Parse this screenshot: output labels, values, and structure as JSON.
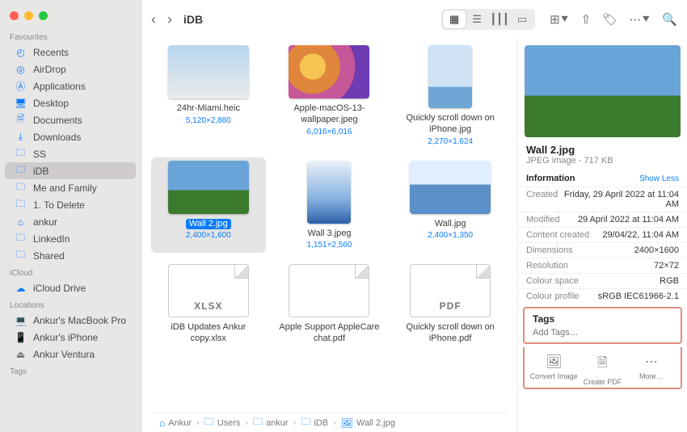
{
  "window": {
    "title": "iDB"
  },
  "sidebar": {
    "groups": [
      {
        "heading": "Favourites",
        "items": [
          {
            "label": "Recents",
            "icon": "clock"
          },
          {
            "label": "AirDrop",
            "icon": "airdrop"
          },
          {
            "label": "Applications",
            "icon": "apps"
          },
          {
            "label": "Desktop",
            "icon": "desktop"
          },
          {
            "label": "Documents",
            "icon": "doc"
          },
          {
            "label": "Downloads",
            "icon": "download"
          },
          {
            "label": "SS",
            "icon": "folder"
          },
          {
            "label": "iDB",
            "icon": "folder",
            "selected": true
          },
          {
            "label": "Me and Family",
            "icon": "folder"
          },
          {
            "label": "1. To Delete",
            "icon": "folder"
          },
          {
            "label": "ankur",
            "icon": "home"
          },
          {
            "label": "LinkedIn",
            "icon": "folder"
          },
          {
            "label": "Shared",
            "icon": "folder"
          }
        ]
      },
      {
        "heading": "iCloud",
        "items": [
          {
            "label": "iCloud Drive",
            "icon": "icloud"
          }
        ]
      },
      {
        "heading": "Locations",
        "items": [
          {
            "label": "Ankur's MacBook Pro",
            "icon": "laptop"
          },
          {
            "label": "Ankur's iPhone",
            "icon": "phone"
          },
          {
            "label": "Ankur Ventura",
            "icon": "disk"
          }
        ]
      },
      {
        "heading": "Tags",
        "items": []
      }
    ]
  },
  "files": [
    {
      "name": "24hr-Miami.heic",
      "dim": "5,120×2,880",
      "art": "bg-city"
    },
    {
      "name": "Apple-macOS-13-wallpaper.jpeg",
      "dim": "6,016×6,016",
      "art": "bg-ventura"
    },
    {
      "name": "Quickly scroll down on iPhone.jpg",
      "dim": "2,270×1,624",
      "art": "bg-bluegrad",
      "portrait": true
    },
    {
      "name": "Wall 2.jpg",
      "dim": "2,400×1,600",
      "art": "bg-wall2",
      "selected": true
    },
    {
      "name": "Wall 3.jpeg",
      "dim": "1,151×2,560",
      "art": "bg-wall3",
      "portrait": true
    },
    {
      "name": "Wall.jpg",
      "dim": "2,400×1,350",
      "art": "bg-wall"
    },
    {
      "name": "iDB Updates Ankur copy.xlsx",
      "ext": "XLSX",
      "doc": true
    },
    {
      "name": "Apple Support AppleCare chat.pdf",
      "ext": "",
      "doc": true
    },
    {
      "name": "Quickly scroll down on iPhone.pdf",
      "ext": "PDF",
      "doc": true
    }
  ],
  "path": [
    "Ankur",
    "Users",
    "ankur",
    "iDB",
    "Wall 2.jpg"
  ],
  "inspector": {
    "name": "Wall 2.jpg",
    "sub": "JPEG image - 717 KB",
    "info_heading": "Information",
    "show_less": "Show Less",
    "rows": [
      {
        "k": "Created",
        "v": "Friday, 29 April 2022 at 11:04 AM"
      },
      {
        "k": "Modified",
        "v": "29 April 2022 at 11:04 AM"
      },
      {
        "k": "Content created",
        "v": "29/04/22, 11:04 AM"
      },
      {
        "k": "Dimensions",
        "v": "2400×1600"
      },
      {
        "k": "Resolution",
        "v": "72×72"
      },
      {
        "k": "Colour space",
        "v": "RGB"
      },
      {
        "k": "Colour profile",
        "v": "sRGB IEC61966-2.1"
      }
    ],
    "tags_heading": "Tags",
    "tags_placeholder": "Add Tags…",
    "actions": [
      {
        "label": "Convert Image",
        "icon": "image"
      },
      {
        "label": "Create PDF",
        "icon": "doc"
      },
      {
        "label": "More…",
        "icon": "more"
      }
    ]
  }
}
